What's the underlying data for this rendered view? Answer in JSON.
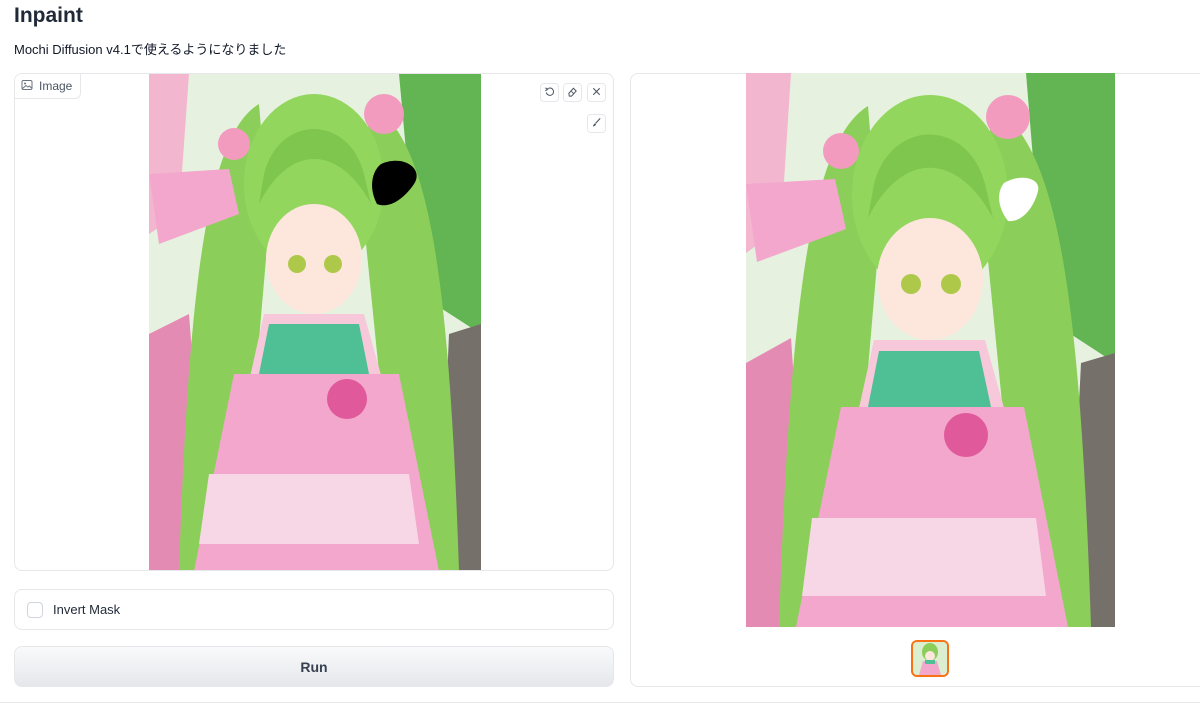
{
  "page": {
    "title": "Inpaint",
    "subtitle": "Mochi Diffusion v4.1で使えるようになりました"
  },
  "input_image": {
    "label": "Image",
    "tools": [
      "undo-icon",
      "eraser-icon",
      "close-icon",
      "brush-icon"
    ]
  },
  "options": {
    "invert_mask_label": "Invert Mask",
    "invert_mask_checked": false
  },
  "actions": {
    "run_label": "Run"
  },
  "colors": {
    "accent_thumb_border": "#f97316",
    "border": "#e5e7eb",
    "hair": "#8bcf5a",
    "dress": "#f3a7cd",
    "bodice": "#4fbf96"
  }
}
